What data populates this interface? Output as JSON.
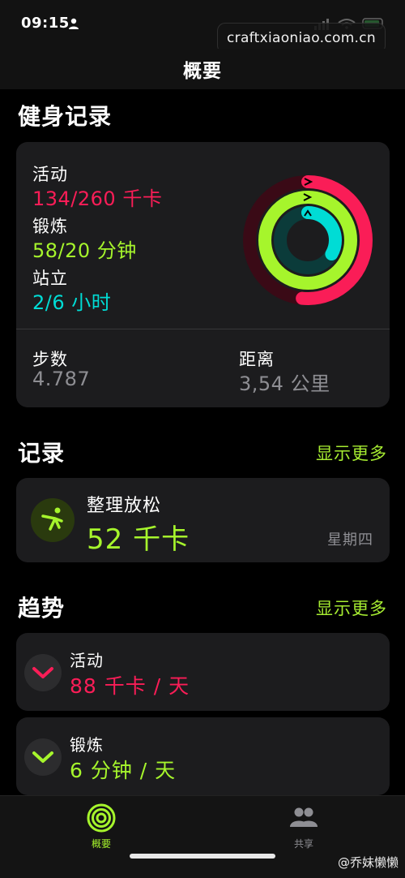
{
  "status_bar": {
    "time": "09:15",
    "watermark": "craftxiaoniao.com.cn"
  },
  "nav": {
    "title": "概要"
  },
  "fitness_record": {
    "title": "健身记录",
    "move": {
      "label": "活动",
      "value": "134/260 千卡",
      "progress": 0.515
    },
    "exercise": {
      "label": "锻炼",
      "value": "58/20 分钟",
      "progress": 2.9
    },
    "stand": {
      "label": "站立",
      "value": "2/6 小时",
      "progress": 0.333
    },
    "steps": {
      "label": "步数",
      "value": "4.787"
    },
    "distance": {
      "label": "距离",
      "value": "3,54 公里"
    }
  },
  "records": {
    "title": "记录",
    "show_more": "显示更多",
    "workout": {
      "name": "整理放松",
      "value": "52 千卡",
      "day": "星期四"
    }
  },
  "trends": {
    "title": "趋势",
    "show_more": "显示更多",
    "items": [
      {
        "label": "活动",
        "value": "88 千卡 / 天"
      },
      {
        "label": "锻炼",
        "value": "6 分钟 / 天"
      }
    ]
  },
  "tab_bar": {
    "tabs": [
      {
        "label": "概要"
      },
      {
        "label": "共享"
      }
    ]
  },
  "credit": "@乔妹懒懒",
  "colors": {
    "move": "#fa1d57",
    "exercise": "#a6f52c",
    "stand": "#00dcd5",
    "accent": "#a6ec31"
  }
}
